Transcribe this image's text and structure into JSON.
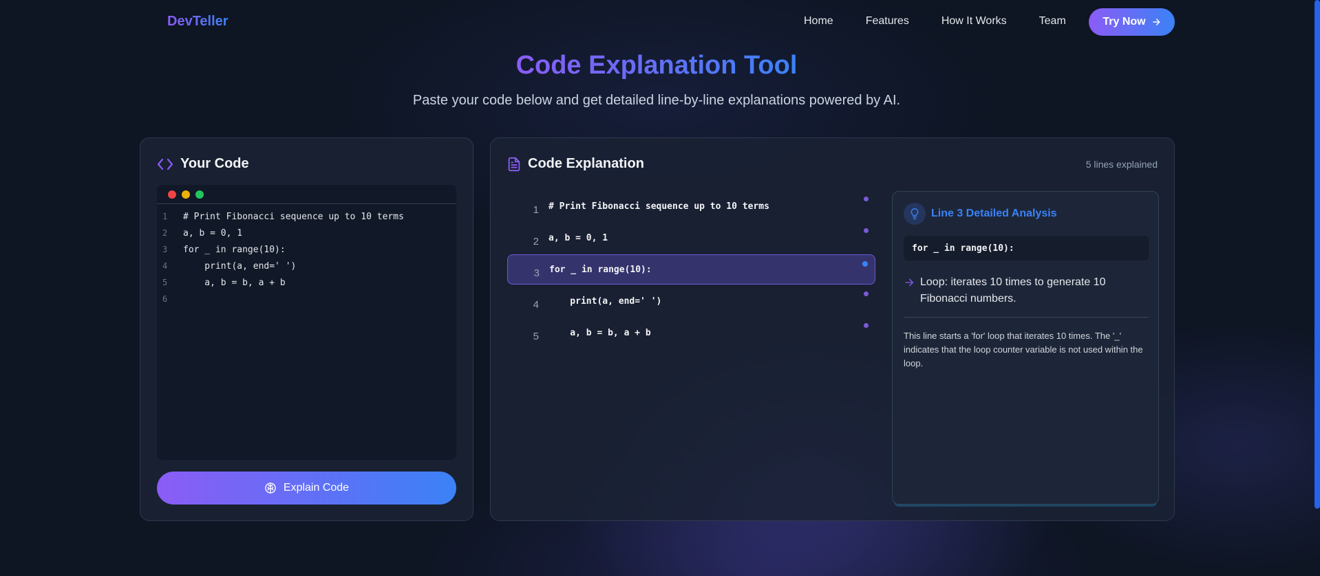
{
  "nav": {
    "brand": "DevTeller",
    "links": [
      "Home",
      "Features",
      "How It Works",
      "Team"
    ],
    "cta": "Try Now"
  },
  "hero": {
    "title": "Code Explanation Tool",
    "subtitle": "Paste your code below and get detailed line-by-line explanations powered by AI."
  },
  "input_panel": {
    "title": "Your Code",
    "code_lines": [
      {
        "n": "1",
        "text": "# Print Fibonacci sequence up to 10 terms"
      },
      {
        "n": "2",
        "text": "a, b = 0, 1"
      },
      {
        "n": "3",
        "text": "for _ in range(10):"
      },
      {
        "n": "4",
        "text": "    print(a, end=' ')"
      },
      {
        "n": "5",
        "text": "    a, b = b, a + b"
      },
      {
        "n": "6",
        "text": ""
      }
    ],
    "button": "Explain Code"
  },
  "explanation_panel": {
    "title": "Code Explanation",
    "count": "5 lines explained",
    "lines": [
      {
        "n": "1",
        "text": "# Print Fibonacci sequence up to 10 terms",
        "active": false
      },
      {
        "n": "2",
        "text": "a, b = 0, 1",
        "active": false
      },
      {
        "n": "3",
        "text": "for _ in range(10):",
        "active": true
      },
      {
        "n": "4",
        "text": "    print(a, end=' ')",
        "active": false
      },
      {
        "n": "5",
        "text": "    a, b = b, a + b",
        "active": false
      }
    ],
    "detail": {
      "title": "Line 3 Detailed Analysis",
      "code": "for _ in range(10):",
      "point": "Loop: iterates 10 times to generate 10 Fibonacci numbers.",
      "body": "This line starts a 'for' loop that iterates 10 times.  The '_' indicates that the loop counter variable is not used within the loop."
    }
  },
  "colors": {
    "accent_purple": "#8b5cf6",
    "accent_blue": "#3b82f6",
    "background": "#0e1523"
  }
}
